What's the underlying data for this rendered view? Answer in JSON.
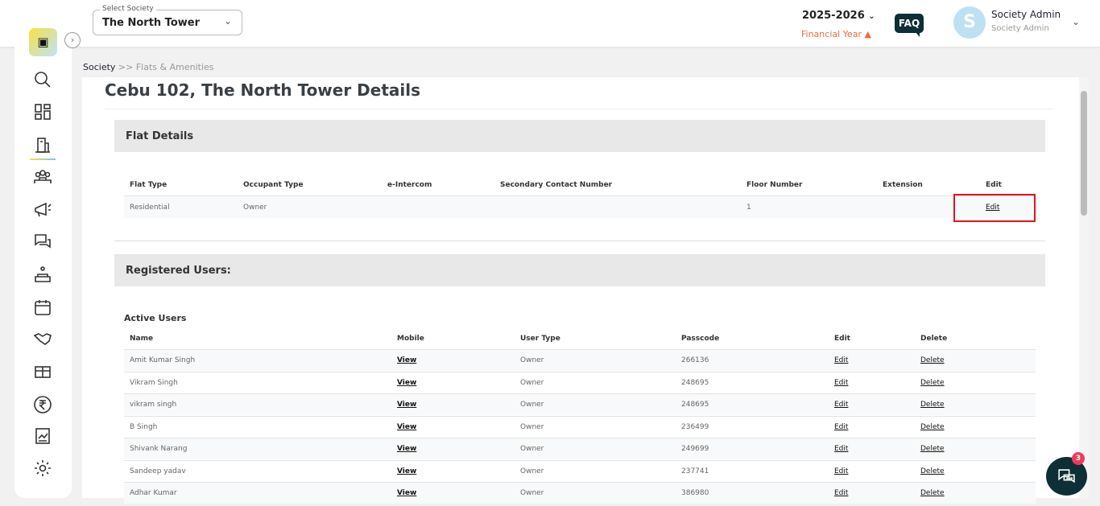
{
  "header": {
    "society_label": "Select Society",
    "society_value": "The North Tower",
    "financial_year": "2025-2026",
    "financial_year_label": "Financial Year",
    "faq": "FAQ",
    "avatar_initial": "S",
    "user_name": "Society Admin",
    "user_role": "Society Admin"
  },
  "logo": "mor",
  "sidebar": {
    "items": [
      "search",
      "dashboard",
      "flats",
      "members",
      "announcements",
      "complaints",
      "facilities",
      "calendar",
      "partners",
      "inventory",
      "accounts",
      "reports",
      "settings"
    ]
  },
  "breadcrumb": {
    "root": "Society",
    "sep": ">>",
    "current": "Flats & Amenities"
  },
  "page": {
    "title": "Cebu 102, The North Tower Details"
  },
  "flat_details": {
    "heading": "Flat Details",
    "columns": [
      "Flat Type",
      "Occupant Type",
      "e-Intercom",
      "Secondary Contact Number",
      "Floor Number",
      "Extension",
      "Edit"
    ],
    "row": {
      "flat_type": "Residential",
      "occupant_type": "Owner",
      "e_intercom": "",
      "secondary_contact": "",
      "floor_number": "1",
      "extension": "",
      "edit": "Edit"
    }
  },
  "registered_users": {
    "heading": "Registered Users:",
    "active_heading": "Active Users",
    "columns": [
      "Name",
      "Mobile",
      "User Type",
      "Passcode",
      "Edit",
      "Delete"
    ],
    "rows": [
      {
        "name": "Amit Kumar Singh",
        "mobile": "View",
        "type": "Owner",
        "passcode": "266136",
        "edit": "Edit",
        "delete": "Delete"
      },
      {
        "name": "Vikram Singh",
        "mobile": "View",
        "type": "Owner",
        "passcode": "248695",
        "edit": "Edit",
        "delete": "Delete"
      },
      {
        "name": "vikram singh",
        "mobile": "View",
        "type": "Owner",
        "passcode": "248695",
        "edit": "Edit",
        "delete": "Delete"
      },
      {
        "name": "B Singh",
        "mobile": "View",
        "type": "Owner",
        "passcode": "236499",
        "edit": "Edit",
        "delete": "Delete"
      },
      {
        "name": "Shivank Narang",
        "mobile": "View",
        "type": "Owner",
        "passcode": "249699",
        "edit": "Edit",
        "delete": "Delete"
      },
      {
        "name": "Sandeep yadav",
        "mobile": "View",
        "type": "Owner",
        "passcode": "237741",
        "edit": "Edit",
        "delete": "Delete"
      },
      {
        "name": "Adhar Kumar",
        "mobile": "View",
        "type": "Owner",
        "passcode": "386980",
        "edit": "Edit",
        "delete": "Delete"
      }
    ]
  },
  "chat": {
    "badge": "3"
  },
  "colors": {
    "accent": "#0d2f36",
    "warning": "#ea6b3d",
    "highlight": "#e0141e"
  }
}
